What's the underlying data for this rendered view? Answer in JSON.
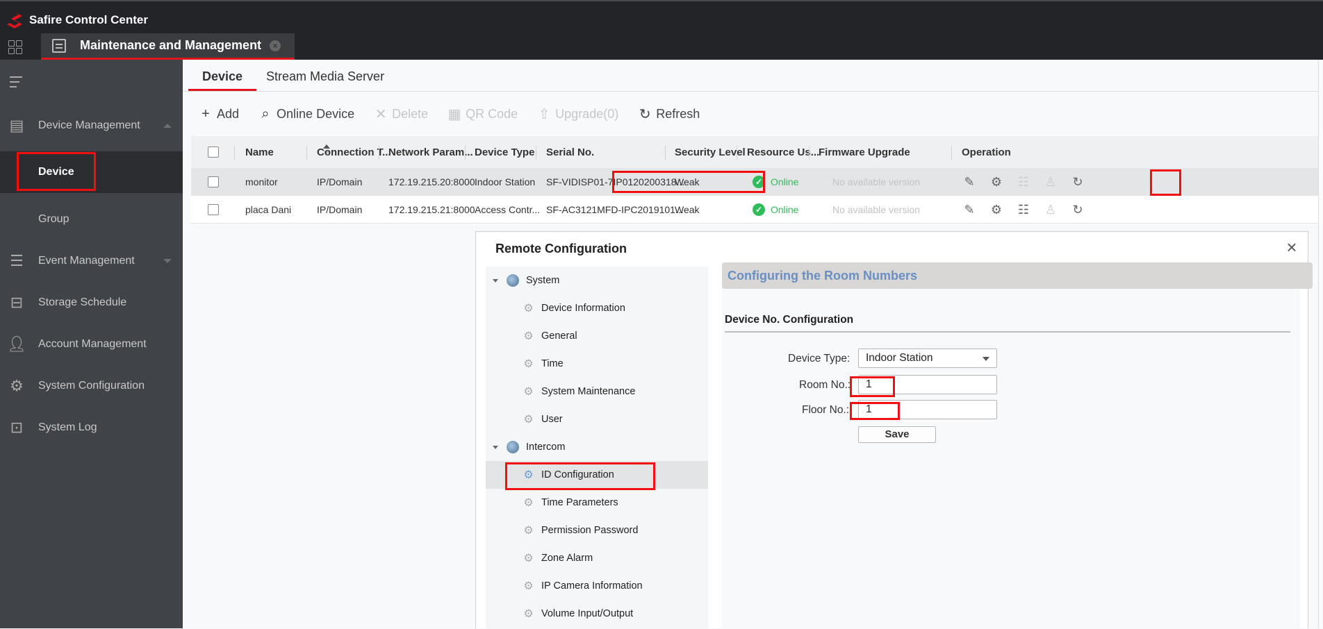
{
  "app": {
    "title": "Safire Control Center",
    "brand_color": "#e0161e",
    "main_tab": {
      "label": "Maintenance and Management",
      "icon": "sliders-icon",
      "close_icon": "close-circle-icon"
    }
  },
  "sidebar": {
    "items": [
      {
        "label": "Device Management",
        "icon": "dvr-icon",
        "expanded": true,
        "children": [
          {
            "label": "Device",
            "active": true
          },
          {
            "label": "Group",
            "active": false
          }
        ]
      },
      {
        "label": "Event Management",
        "icon": "event-list-icon",
        "expanded": false
      },
      {
        "label": "Storage Schedule",
        "icon": "storage-icon"
      },
      {
        "label": "Account Management",
        "icon": "user-icon"
      },
      {
        "label": "System Configuration",
        "icon": "gear-icon"
      },
      {
        "label": "System Log",
        "icon": "log-search-icon"
      }
    ]
  },
  "subtabs": [
    {
      "label": "Device",
      "active": true
    },
    {
      "label": "Stream Media Server",
      "active": false
    }
  ],
  "toolbar": {
    "add": "Add",
    "online_device": "Online Device",
    "delete": "Delete",
    "qr_code": "QR Code",
    "upgrade": "Upgrade(0)",
    "refresh": "Refresh"
  },
  "table": {
    "columns": [
      "Name",
      "Connection T...",
      "Network Param...",
      "Device Type",
      "Serial No.",
      "Security Level",
      "Resource Us...",
      "Firmware Upgrade",
      "Operation"
    ],
    "rows": [
      {
        "name": "monitor",
        "connection": "IP/Domain",
        "network": "172.19.215.20:8000",
        "device_type": "Indoor Station",
        "serial": "SF-VIDISP01-7IP0120200318...",
        "security": "Weak",
        "resource": "Online",
        "firmware": "No available version",
        "selected": true
      },
      {
        "name": "placa Dani",
        "connection": "IP/Domain",
        "network": "172.19.215.21:8000",
        "device_type": "Access Contr...",
        "serial": "SF-AC3121MFD-IPC2019101...",
        "security": "Weak",
        "resource": "Online",
        "firmware": "No available version",
        "selected": false
      }
    ],
    "status_color": "#2fbd5b"
  },
  "dialog": {
    "title": "Remote Configuration",
    "tree": {
      "system": {
        "label": "System",
        "children": [
          "Device Information",
          "General",
          "Time",
          "System Maintenance",
          "User"
        ]
      },
      "intercom": {
        "label": "Intercom",
        "children": [
          "ID Configuration",
          "Time Parameters",
          "Permission Password",
          "Zone Alarm",
          "IP Camera Information",
          "Volume Input/Output"
        ],
        "active": "ID Configuration"
      }
    },
    "panel": {
      "header": "Configuring the Room Numbers",
      "section": "Device No. Configuration",
      "device_type_label": "Device Type:",
      "device_type_value": "Indoor Station",
      "room_label": "Room No.:",
      "room_value": "1",
      "floor_label": "Floor No.:",
      "floor_value": "1",
      "save": "Save"
    }
  }
}
